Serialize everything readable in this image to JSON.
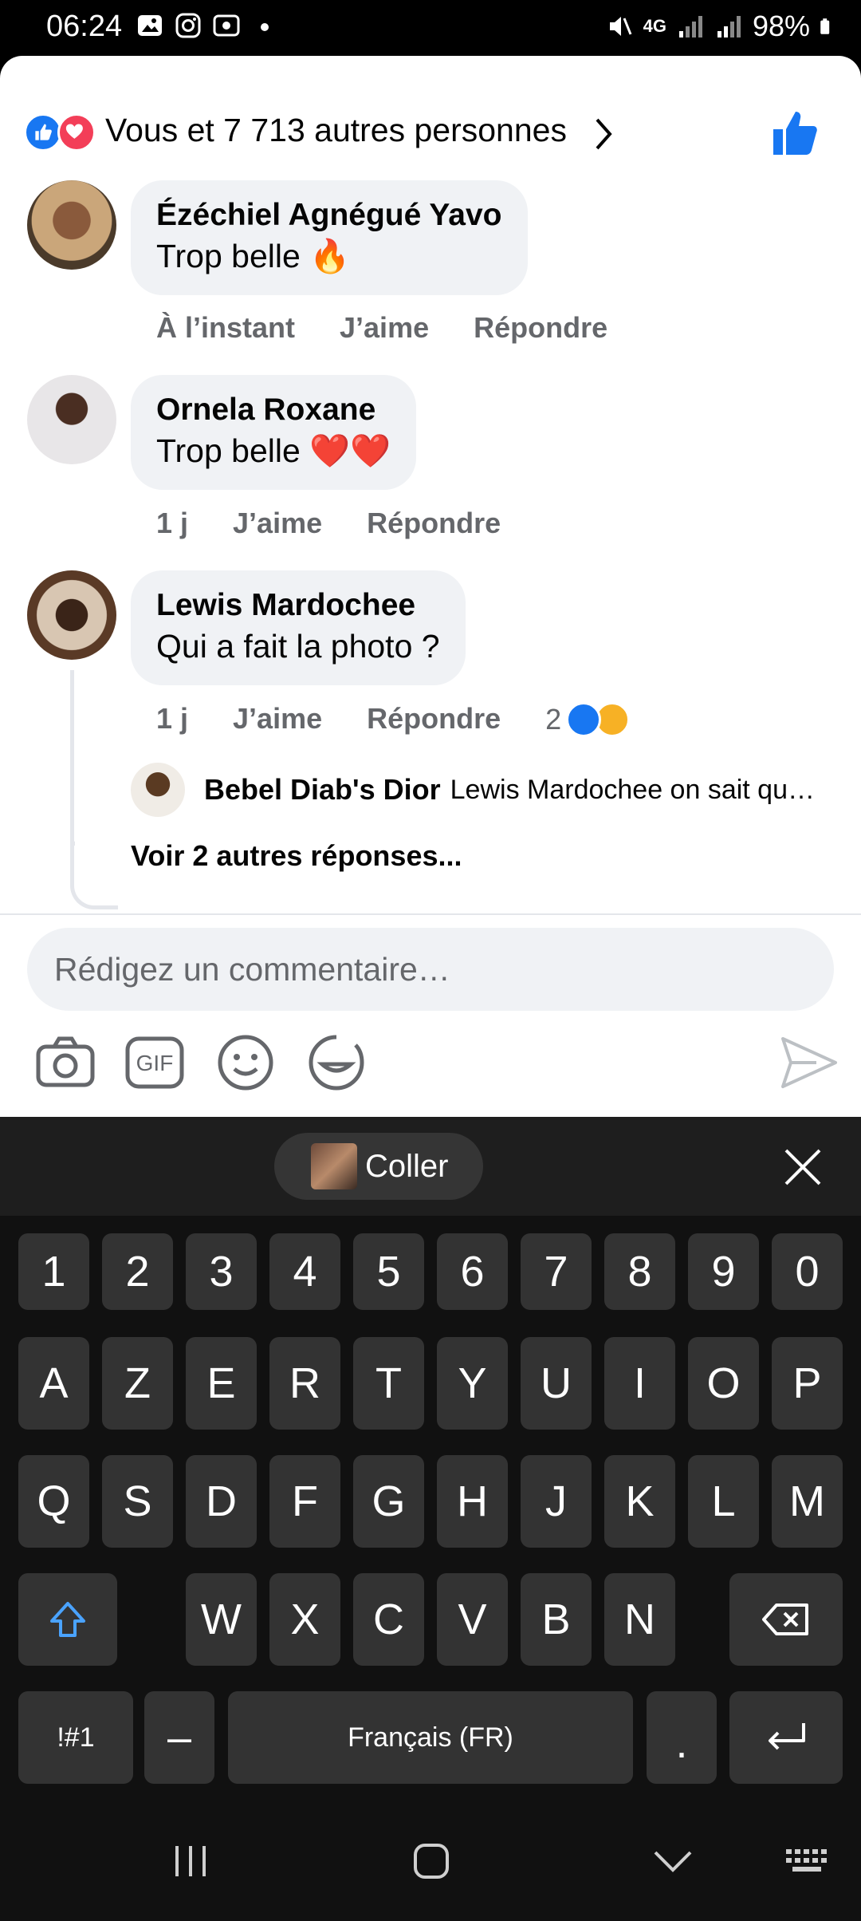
{
  "status": {
    "time": "06:24",
    "battery": "98%",
    "network": "4G"
  },
  "reactions": {
    "summary": "Vous et 7 713 autres personnes",
    "icons": [
      "like-icon",
      "love-icon"
    ]
  },
  "comments": [
    {
      "name": "Ézéchiel Agnégué Yavo",
      "text": "Trop belle 🔥",
      "time": "À l’instant",
      "like": "J’aime",
      "reply": "Répondre"
    },
    {
      "name": "Ornela Roxane",
      "text": "Trop belle ❤️❤️",
      "time": "1 j",
      "like": "J’aime",
      "reply": "Répondre"
    },
    {
      "name": "Lewis Mardochee",
      "text": "Qui a fait la photo ?",
      "time": "1 j",
      "like": "J’aime",
      "reply": "Répondre",
      "reaction_count": "2",
      "reaction_icons": [
        "like-icon",
        "haha-icon"
      ],
      "reply_preview": {
        "name": "Bebel Diab's Dior",
        "text": "Lewis Mardochee on sait qu…"
      },
      "more_replies": "Voir 2 autres réponses..."
    }
  ],
  "composer": {
    "placeholder": "Rédigez un commentaire…",
    "tools": [
      "camera-icon",
      "gif-icon",
      "emoji-icon",
      "sticker-icon",
      "send-icon"
    ]
  },
  "keyboard": {
    "paste_label": "Coller",
    "row_numbers": [
      "1",
      "2",
      "3",
      "4",
      "5",
      "6",
      "7",
      "8",
      "9",
      "0"
    ],
    "row1": [
      "A",
      "Z",
      "E",
      "R",
      "T",
      "Y",
      "U",
      "I",
      "O",
      "P"
    ],
    "row2": [
      "Q",
      "S",
      "D",
      "F",
      "G",
      "H",
      "J",
      "K",
      "L",
      "M"
    ],
    "row3": [
      "W",
      "X",
      "C",
      "V",
      "B",
      "N"
    ],
    "symbols": "!#1",
    "dash": "–",
    "space": "Français (FR)",
    "period": "."
  },
  "colors": {
    "accent": "#1877f2",
    "love": "#f33e58",
    "bubble": "#f0f2f5",
    "meta": "#65676b"
  }
}
